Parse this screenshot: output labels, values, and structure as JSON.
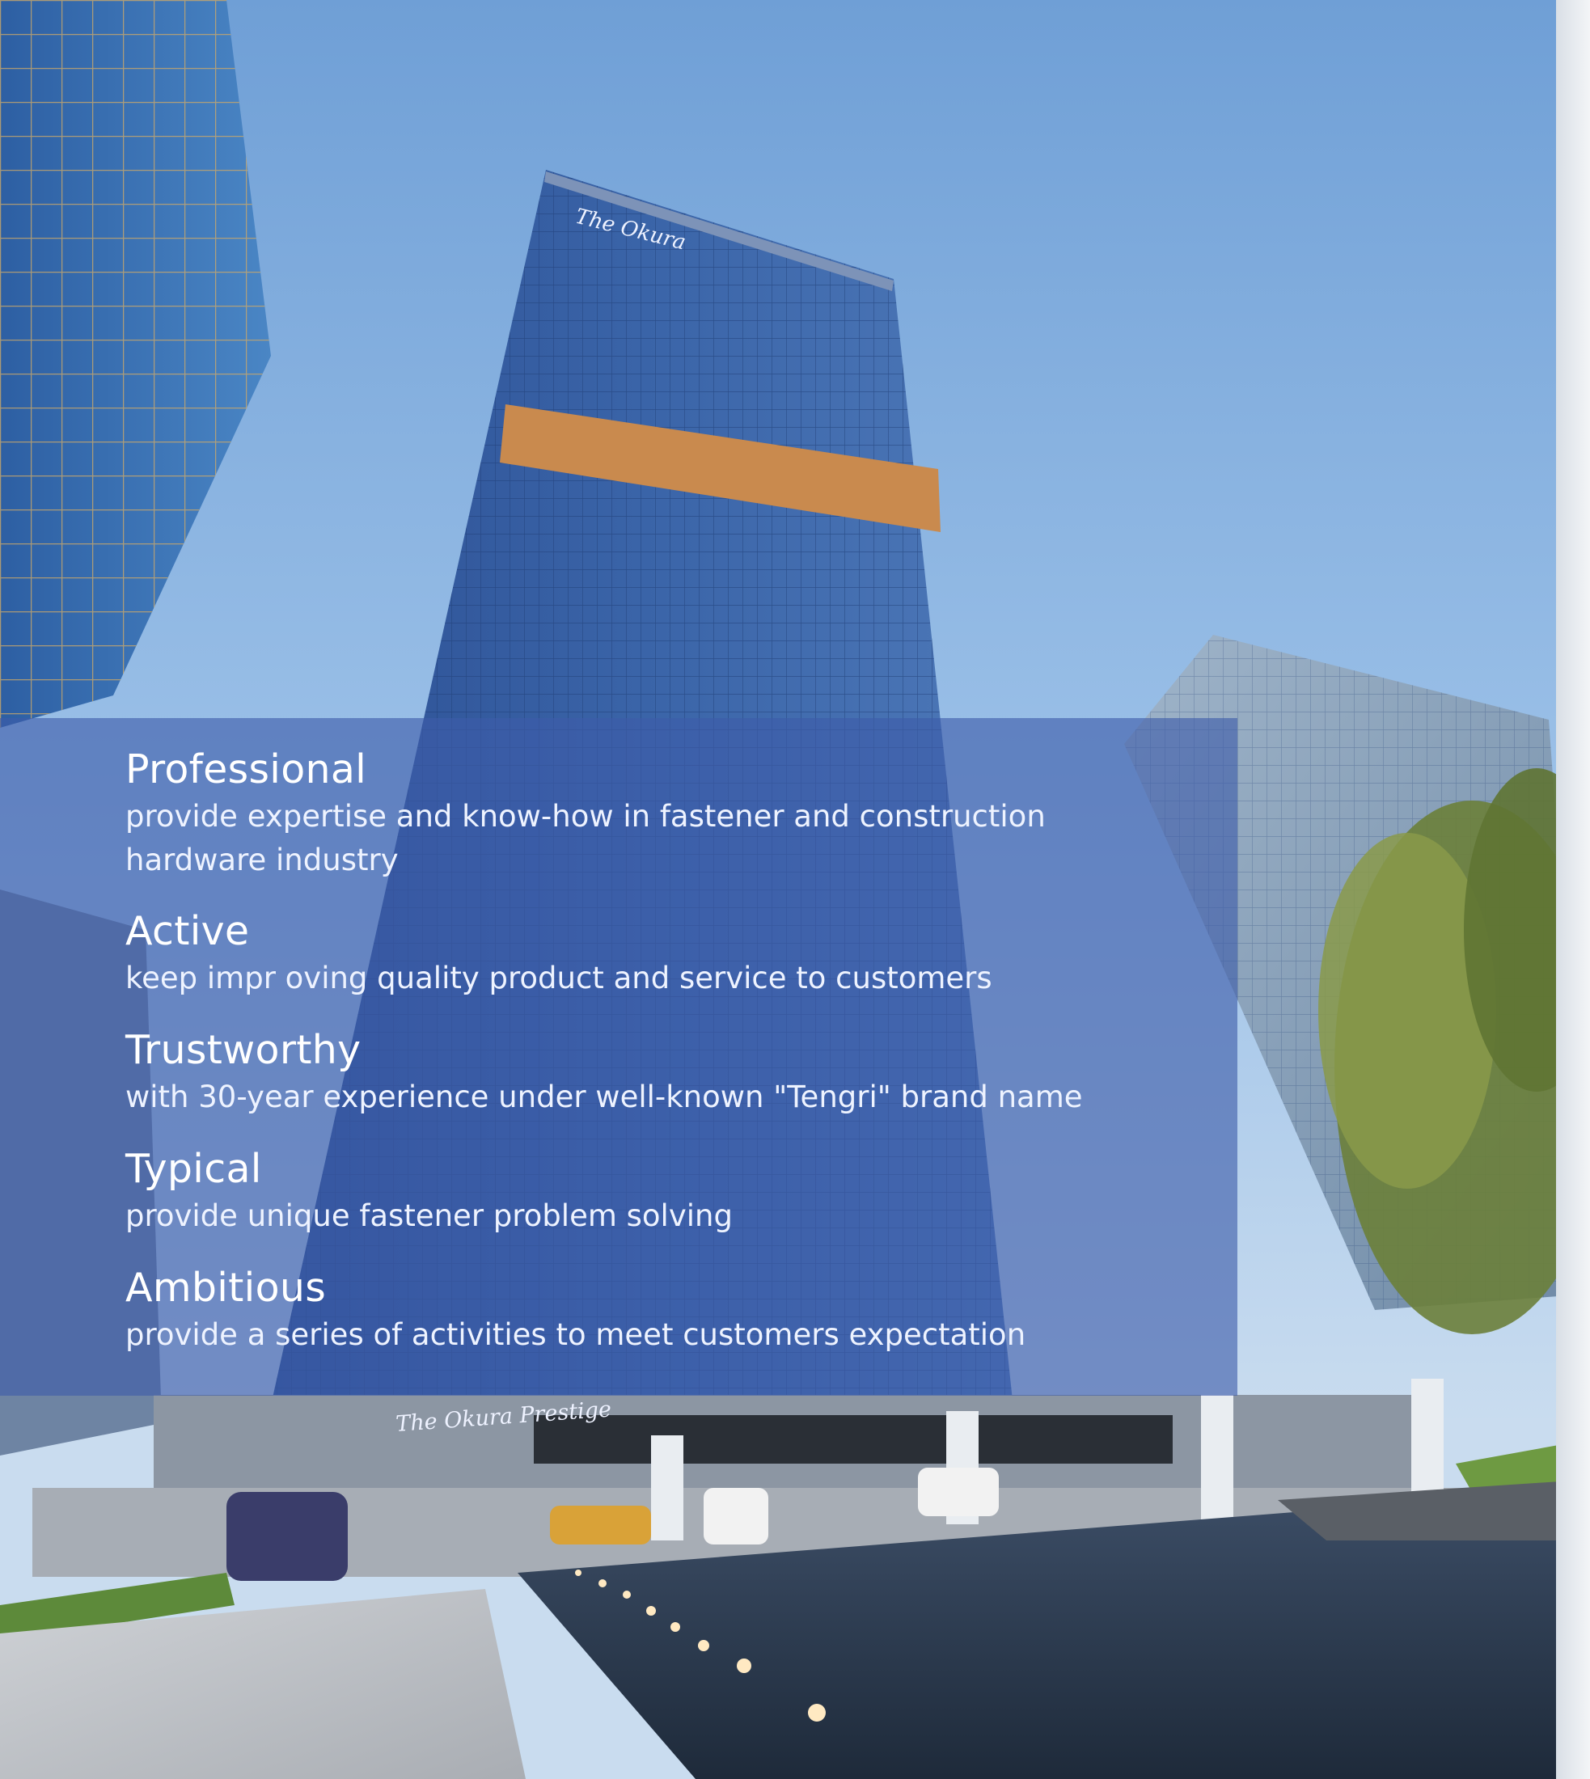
{
  "values": [
    {
      "title": "Professional",
      "desc_lines": [
        "provide expertise and know-how in fastener and construction",
        "hardware industry"
      ]
    },
    {
      "title": "Active",
      "desc_lines": [
        "keep impr oving quality product and service to customers"
      ]
    },
    {
      "title": "Trustworthy",
      "desc_lines": [
        "with 30-year experience under well-known \"Tengri\" brand name"
      ]
    },
    {
      "title": "Typical",
      "desc_lines": [
        "provide unique fastener problem solving"
      ]
    },
    {
      "title": "Ambitious",
      "desc_lines": [
        "provide a series of activities to meet customers expectation"
      ]
    }
  ],
  "signage": {
    "tower_logo": "The Okura",
    "entrance_logo": "The Okura Prestige"
  },
  "colors": {
    "sky": "#8fb8e4",
    "panel": "#3e5caa",
    "text": "#ffffff"
  }
}
